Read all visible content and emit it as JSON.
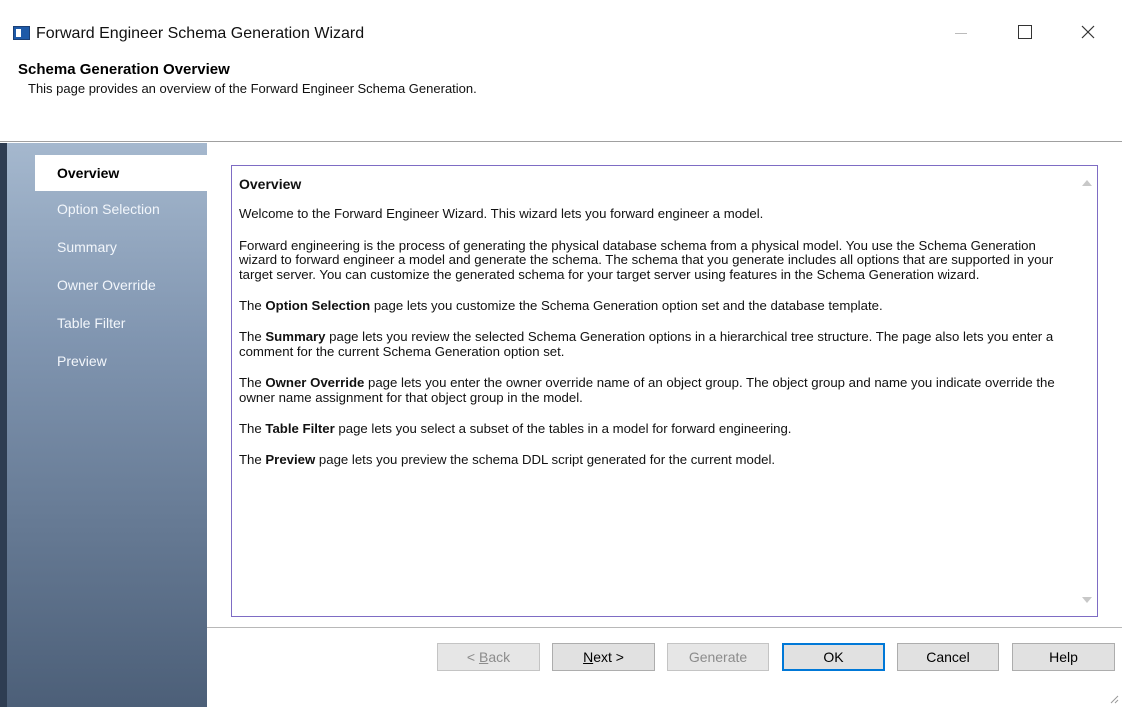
{
  "window": {
    "title": "Forward Engineer Schema Generation Wizard",
    "app_icon": "wizard-app-icon",
    "controls": {
      "minimize": "minimize-icon",
      "maximize": "maximize-icon",
      "close": "close-icon"
    }
  },
  "header": {
    "title": "Schema Generation Overview",
    "subtitle": "This page provides an overview of the Forward Engineer Schema Generation."
  },
  "sidebar": {
    "items": [
      {
        "label": "Overview",
        "active": true
      },
      {
        "label": "Option Selection",
        "active": false
      },
      {
        "label": "Summary",
        "active": false
      },
      {
        "label": "Owner Override",
        "active": false
      },
      {
        "label": "Table Filter",
        "active": false
      },
      {
        "label": "Preview",
        "active": false
      }
    ]
  },
  "content": {
    "heading": "Overview",
    "intro": "Welcome to the Forward Engineer Wizard. This wizard lets you forward engineer a model.",
    "description": "Forward engineering is the process of generating the physical database schema from a physical model. You use the Schema Generation  wizard to forward engineer a model and generate the  schema. The schema that you generate includes all options that are supported in your target server. You can customize the generated schema for your target server using features in the Schema Generation wizard.",
    "pages": [
      {
        "prefix": "The ",
        "name": "Option Selection",
        "text": " page lets you customize the Schema Generation option set and the database template."
      },
      {
        "prefix": "The ",
        "name": "Summary",
        "text": " page lets you review the selected Schema Generation options in a hierarchical tree structure. The page also lets you enter a comment for the current Schema Generation option set."
      },
      {
        "prefix": "The ",
        "name": "Owner Override",
        "text": " page lets you enter the owner override name of an object group. The object group and name you indicate override the owner name assignment for that object group in the model."
      },
      {
        "prefix": "The ",
        "name": "Table Filter",
        "text": " page lets you select a subset of the tables in a model for forward engineering."
      },
      {
        "prefix": "The ",
        "name": "Preview",
        "text": " page lets you preview the schema DDL script generated for the current model."
      }
    ]
  },
  "buttons": {
    "back": {
      "mnemonic": "B",
      "rest": "ack",
      "prefix": "< ",
      "enabled": false
    },
    "next": {
      "mnemonic": "N",
      "rest": "ext >",
      "enabled": true
    },
    "generate": {
      "label": "Generate",
      "enabled": false
    },
    "ok": {
      "label": "OK",
      "enabled": true,
      "default": true
    },
    "cancel": {
      "label": "Cancel",
      "enabled": true
    },
    "help": {
      "label": "Help",
      "enabled": true
    }
  },
  "colors": {
    "sidebar_top": "#a5b8ce",
    "sidebar_bottom": "#4c5f78",
    "textbox_border": "#7e6cc4",
    "default_button_border": "#0078d7"
  }
}
